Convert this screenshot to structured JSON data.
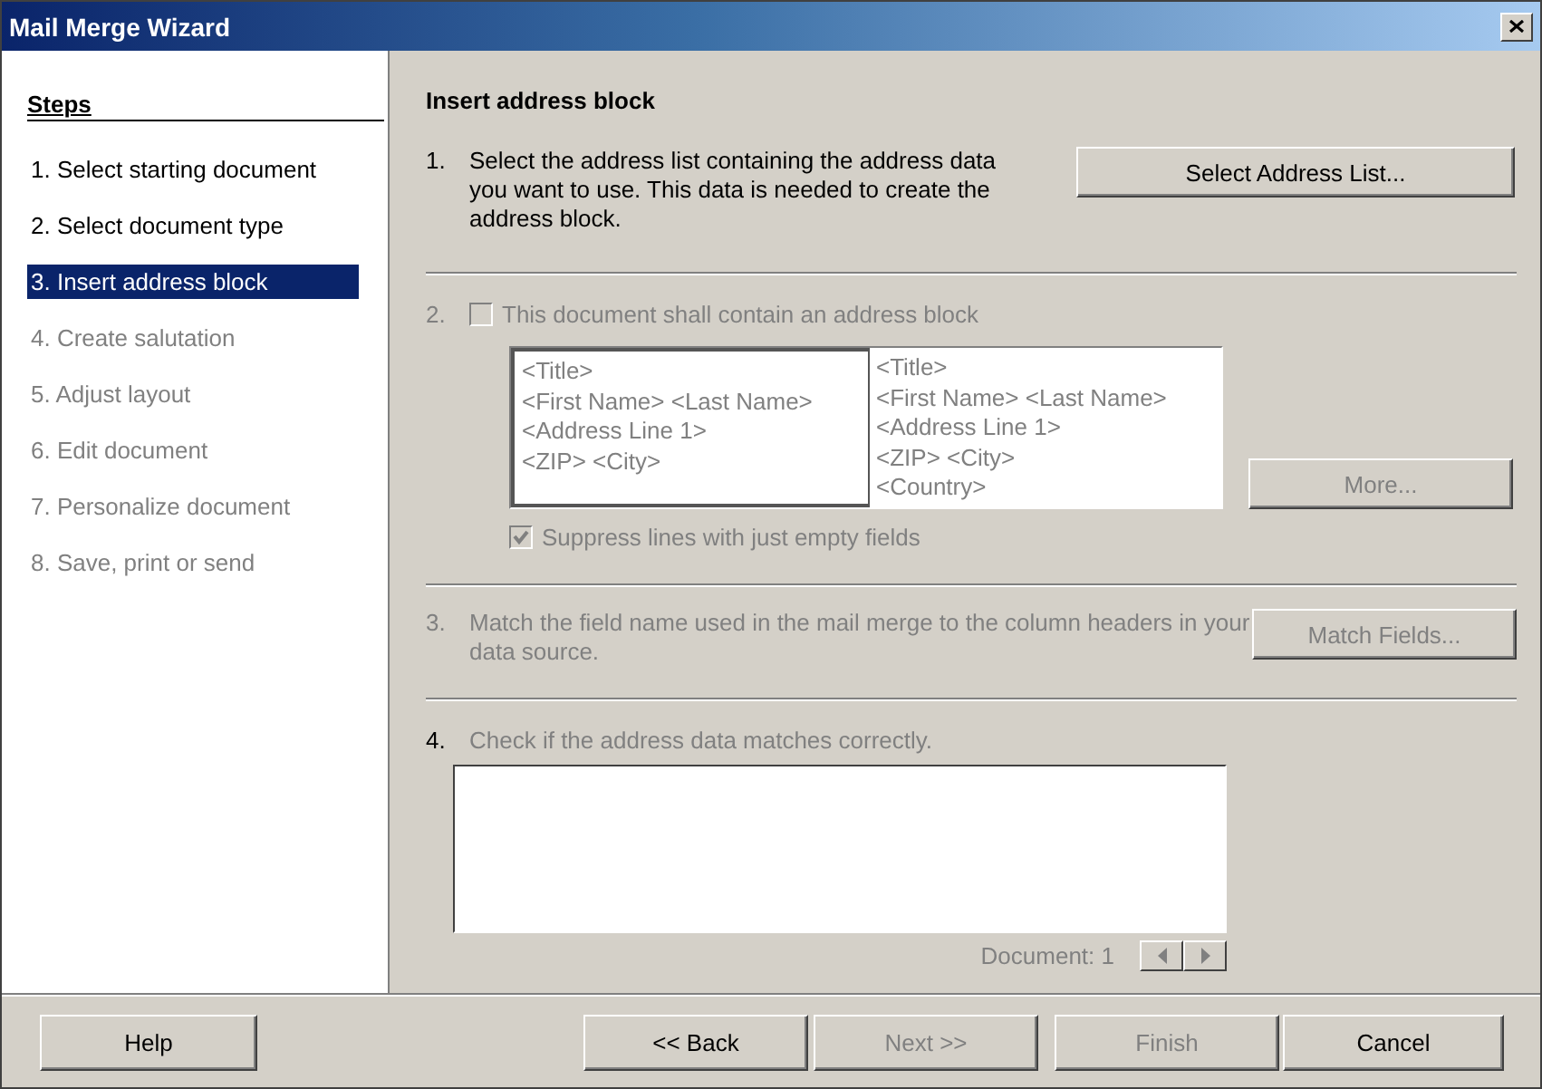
{
  "window": {
    "title": "Mail Merge Wizard"
  },
  "steps": {
    "heading": "Steps",
    "items": [
      {
        "label": "1. Select starting document",
        "selected": false,
        "disabled": false
      },
      {
        "label": "2. Select document type",
        "selected": false,
        "disabled": false
      },
      {
        "label": "3. Insert address block",
        "selected": true,
        "disabled": false
      },
      {
        "label": "4. Create salutation",
        "selected": false,
        "disabled": true
      },
      {
        "label": "5. Adjust layout",
        "selected": false,
        "disabled": true
      },
      {
        "label": "6. Edit document",
        "selected": false,
        "disabled": true
      },
      {
        "label": "7. Personalize document",
        "selected": false,
        "disabled": true
      },
      {
        "label": "8. Save, print or send",
        "selected": false,
        "disabled": true
      }
    ]
  },
  "page": {
    "title": "Insert address block",
    "section_1": {
      "number": "1.",
      "number_disabled": false,
      "text": "Select the address list containing the address data you want to use. This data is needed to create the address block.",
      "disabled": false,
      "button": {
        "label": "Select Address List...",
        "disabled": false
      }
    },
    "section_2": {
      "number": "2.",
      "number_disabled": true,
      "checkbox": {
        "label": "This document shall contain an address block",
        "checked": false,
        "disabled": true
      },
      "blocks": [
        {
          "lines": [
            "<Title>",
            "<First Name> <Last Name>",
            "<Address Line 1>",
            "<ZIP> <City>"
          ],
          "selected": true
        },
        {
          "lines": [
            "<Title>",
            "<First Name> <Last Name>",
            "<Address Line 1>",
            "<ZIP> <City>",
            "<Country>"
          ],
          "selected": false
        }
      ],
      "button": {
        "label": "More...",
        "disabled": true
      },
      "suppress": {
        "label": "Suppress lines with just empty fields",
        "checked": true,
        "disabled": true
      }
    },
    "section_3": {
      "number": "3.",
      "number_disabled": true,
      "text": "Match the field name used in the mail merge to the column headers in your data source.",
      "disabled": true,
      "button": {
        "label": "Match Fields...",
        "disabled": true
      }
    },
    "section_4": {
      "number": "4.",
      "number_disabled": false,
      "text": "Check if the address data matches correctly.",
      "disabled": true,
      "document_label": "Document: 1"
    }
  },
  "buttons": [
    {
      "label": "Help",
      "disabled": false
    },
    {
      "label": "<< Back",
      "disabled": false
    },
    {
      "label": "Next >>",
      "disabled": true
    },
    {
      "label": "Finish",
      "disabled": true
    },
    {
      "label": "Cancel",
      "disabled": false
    }
  ]
}
